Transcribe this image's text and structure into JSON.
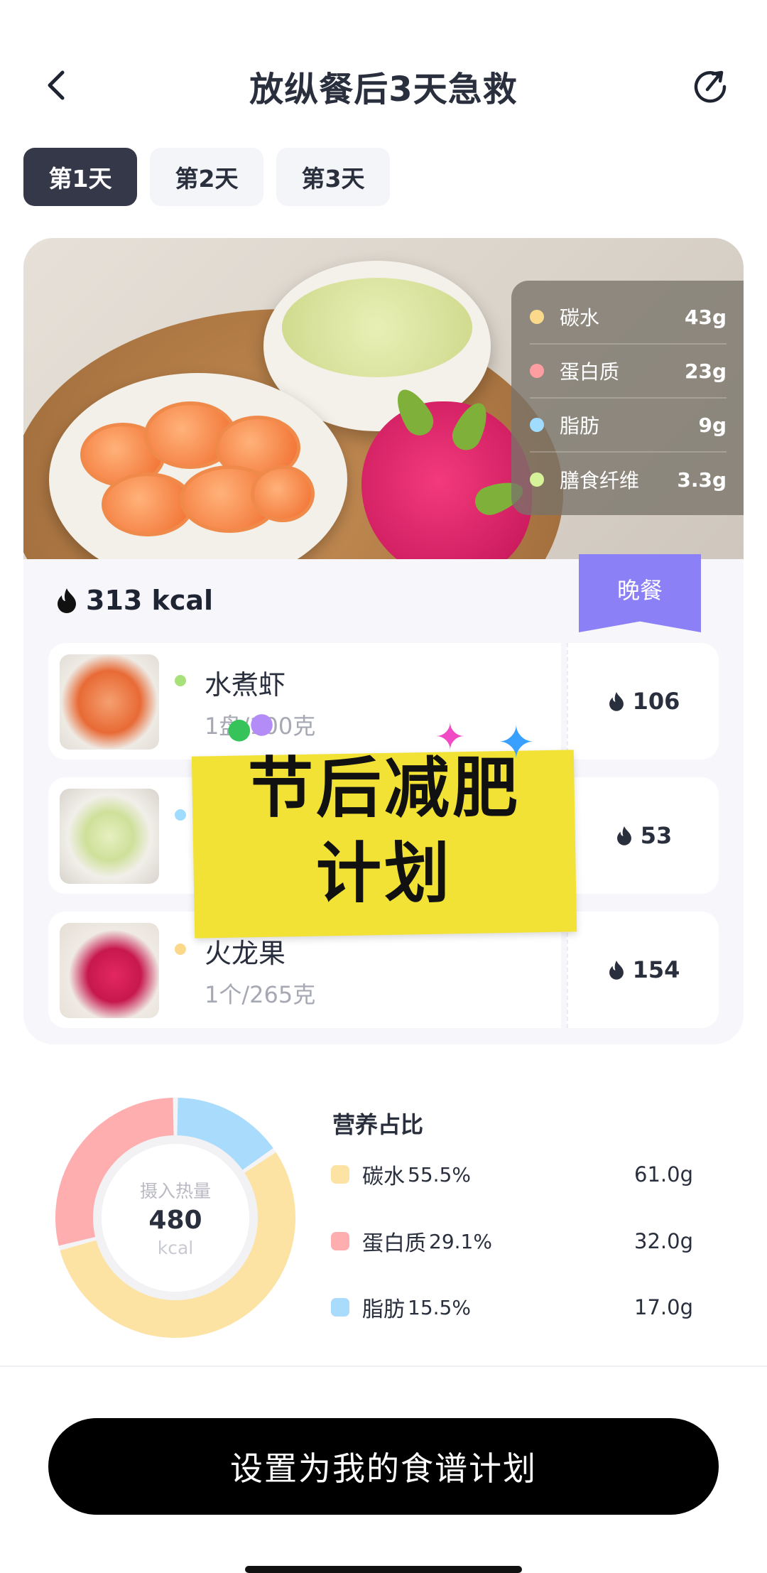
{
  "header": {
    "title": "放纵餐后3天急救",
    "back_icon": "chevron-left-icon",
    "share_icon": "share-icon"
  },
  "tabs": [
    {
      "label": "第1天",
      "active": true
    },
    {
      "label": "第2天",
      "active": false
    },
    {
      "label": "第3天",
      "active": false
    }
  ],
  "meal": {
    "badge": "晚餐",
    "kcal_label": "313 kcal",
    "macros": [
      {
        "name": "碳水",
        "value": "43g",
        "color": "#fbd98a"
      },
      {
        "name": "蛋白质",
        "value": "23g",
        "color": "#ff9ea0"
      },
      {
        "name": "脂肪",
        "value": "9g",
        "color": "#9fdcff"
      },
      {
        "name": "膳食纤维",
        "value": "3.3g",
        "color": "#d6f39a"
      }
    ],
    "foods": [
      {
        "name": "水煮虾",
        "qty": "1盘/100克",
        "kcal": "106",
        "dot_color": "#a8e07a"
      },
      {
        "name": "",
        "qty": "",
        "kcal": "53",
        "dot_color": "#9fdcff"
      },
      {
        "name": "火龙果",
        "qty": "1个/265克",
        "kcal": "154",
        "dot_color": "#fbd98a"
      }
    ]
  },
  "overlay": {
    "line1": "节后减肥",
    "line2": "计划"
  },
  "nutrition": {
    "title": "营养占比",
    "center_label": "摄入热量",
    "center_value": "480",
    "center_unit": "kcal",
    "items": [
      {
        "name": "碳水",
        "pct": "55.5%",
        "gram": "61.0g",
        "color": "#fde3a3",
        "share": 0.555
      },
      {
        "name": "蛋白质",
        "pct": "29.1%",
        "gram": "32.0g",
        "color": "#ffaeb0",
        "share": 0.291
      },
      {
        "name": "脂肪",
        "pct": "15.5%",
        "gram": "17.0g",
        "color": "#a9dcfc",
        "share": 0.155
      }
    ]
  },
  "cta": {
    "label": "设置为我的食谱计划"
  }
}
